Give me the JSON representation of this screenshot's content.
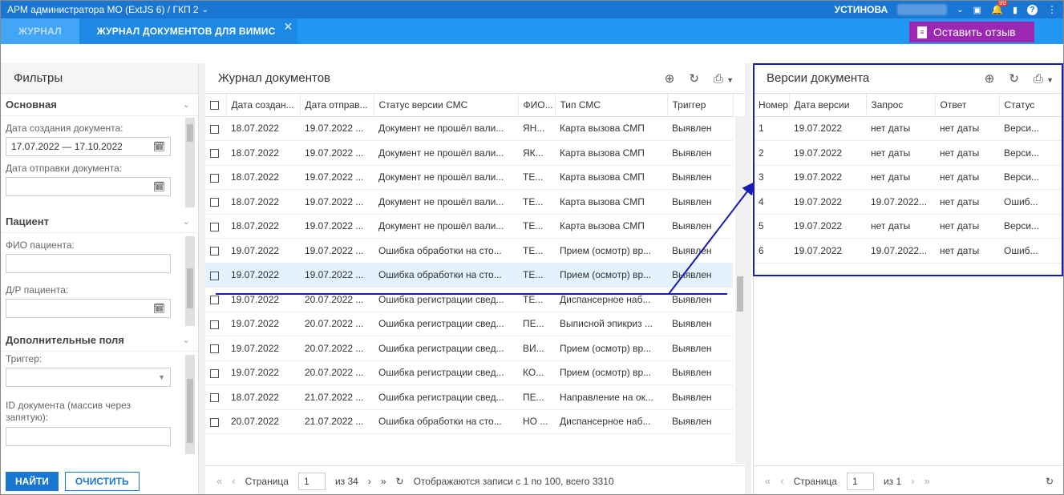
{
  "topbar": {
    "title": "АРМ администратора МО (ExtJS 6) / ГКП 2",
    "user": "УСТИНОВА",
    "notif_count": "99"
  },
  "tabs": [
    {
      "label": "ЖУРНАЛ"
    },
    {
      "label": "ЖУРНАЛ ДОКУМЕНТОВ ДЛЯ ВИМИС"
    }
  ],
  "feedback_label": "Оставить отзыв",
  "filters": {
    "title": "Фильтры",
    "main": {
      "title": "Основная",
      "created_label": "Дата создания документа:",
      "created_value": "17.07.2022 — 17.10.2022",
      "sent_label": "Дата отправки документа:",
      "sent_value": ""
    },
    "patient": {
      "title": "Пациент",
      "fio_label": "ФИО пациента:",
      "dob_label": "Д/Р пациента:"
    },
    "extra": {
      "title": "Дополнительные поля",
      "trigger_label": "Триггер:",
      "docid_label": "ID документа (массив через запятую):"
    },
    "find_label": "НАЙТИ",
    "clear_label": "ОЧИСТИТЬ"
  },
  "journal": {
    "title": "Журнал документов",
    "columns": [
      "Дата создан...",
      "Дата отправ...",
      "Статус версии СМС",
      "ФИО...",
      "Тип СМС",
      "Триггер"
    ],
    "rows": [
      [
        "18.07.2022",
        "19.07.2022 ...",
        "Документ не прошёл вали...",
        "ЯН...",
        "Карта вызова СМП",
        "Выявлен"
      ],
      [
        "18.07.2022",
        "19.07.2022 ...",
        "Документ не прошёл вали...",
        "ЯК...",
        "Карта вызова СМП",
        "Выявлен"
      ],
      [
        "18.07.2022",
        "19.07.2022 ...",
        "Документ не прошёл вали...",
        "ТЕ...",
        "Карта вызова СМП",
        "Выявлен"
      ],
      [
        "18.07.2022",
        "19.07.2022 ...",
        "Документ не прошёл вали...",
        "ТЕ...",
        "Карта вызова СМП",
        "Выявлен"
      ],
      [
        "18.07.2022",
        "19.07.2022 ...",
        "Документ не прошёл вали...",
        "ТЕ...",
        "Карта вызова СМП",
        "Выявлен"
      ],
      [
        "19.07.2022",
        "19.07.2022 ...",
        "Ошибка обработки на сто...",
        "ТЕ...",
        "Прием (осмотр) вр...",
        "Выявлен"
      ],
      [
        "19.07.2022",
        "19.07.2022 ...",
        "Ошибка обработки на сто...",
        "ТЕ...",
        "Прием (осмотр) вр...",
        "Выявлен"
      ],
      [
        "19.07.2022",
        "20.07.2022 ...",
        "Ошибка регистрации свед...",
        "ТЕ...",
        "Диспансерное наб...",
        "Выявлен"
      ],
      [
        "19.07.2022",
        "20.07.2022 ...",
        "Ошибка регистрации свед...",
        "ПЕ...",
        "Выписной эпикриз ...",
        "Выявлен"
      ],
      [
        "19.07.2022",
        "20.07.2022 ...",
        "Ошибка регистрации свед...",
        "ВИ...",
        "Прием (осмотр) вр...",
        "Выявлен"
      ],
      [
        "19.07.2022",
        "20.07.2022 ...",
        "Ошибка регистрации свед...",
        "КО...",
        "Прием (осмотр) вр...",
        "Выявлен"
      ],
      [
        "18.07.2022",
        "21.07.2022 ...",
        "Ошибка регистрации свед...",
        "ПЕ...",
        "Направление на ок...",
        "Выявлен"
      ],
      [
        "20.07.2022",
        "21.07.2022 ...",
        "Ошибка обработки на сто...",
        "НО ...",
        "Диспансерное наб...",
        "Выявлен"
      ]
    ],
    "status_link_rows": [
      0,
      1,
      2,
      3,
      4,
      7,
      8,
      9,
      10,
      11
    ],
    "selected_row": 6,
    "pager": {
      "page_label": "Страница",
      "page": "1",
      "of": "из 34",
      "summary": "Отображаются записи с 1 по 100, всего 3310"
    }
  },
  "versions": {
    "title": "Версии документа",
    "columns": [
      "Номер...",
      "Дата версии",
      "Запрос",
      "Ответ",
      "Статус"
    ],
    "rows": [
      [
        "1",
        "19.07.2022",
        "нет даты",
        "нет даты",
        "Верси..."
      ],
      [
        "2",
        "19.07.2022",
        "нет даты",
        "нет даты",
        "Верси..."
      ],
      [
        "3",
        "19.07.2022",
        "нет даты",
        "нет даты",
        "Верси..."
      ],
      [
        "4",
        "19.07.2022",
        "19.07.2022...",
        "нет даты",
        "Ошиб..."
      ],
      [
        "5",
        "19.07.2022",
        "нет даты",
        "нет даты",
        "Верси..."
      ],
      [
        "6",
        "19.07.2022",
        "19.07.2022...",
        "нет даты",
        "Ошиб..."
      ]
    ],
    "link_rows": [
      3,
      5
    ],
    "pager": {
      "page_label": "Страница",
      "page": "1",
      "of": "из 1"
    }
  },
  "colors": {
    "topbar": "#1976d2",
    "tabbar": "#2196f3",
    "feedback": "#9c27b0",
    "link": "#1e88e5",
    "annotation": "#1a1ab4"
  }
}
